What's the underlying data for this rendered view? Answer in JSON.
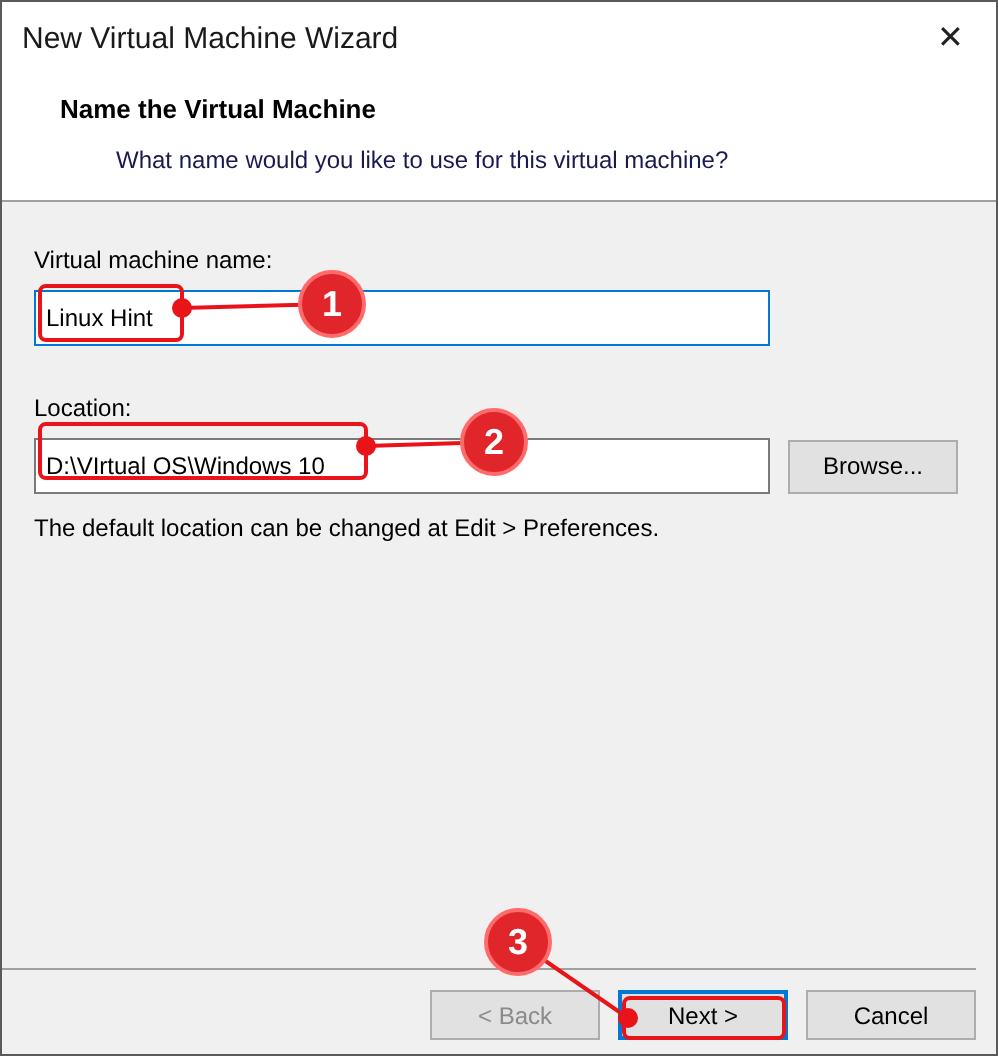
{
  "window": {
    "title": "New Virtual Machine Wizard",
    "close": "✕"
  },
  "header": {
    "title": "Name the Virtual Machine",
    "subtitle": "What name would you like to use for this virtual machine?"
  },
  "fields": [
    {
      "label": "Virtual machine name:",
      "value": "Linux Hint",
      "focused": true
    },
    {
      "label": "Location:",
      "value": "D:\\VIrtual OS\\Windows 10",
      "focused": false,
      "button": "Browse..."
    }
  ],
  "note": "The default location can be changed at Edit > Preferences.",
  "buttons": [
    {
      "label": "< Back",
      "disabled": true,
      "focused": false
    },
    {
      "label": "Next >",
      "disabled": false,
      "focused": true
    },
    {
      "label": "Cancel",
      "disabled": false,
      "focused": false
    }
  ],
  "annotations": [
    {
      "number": "1"
    },
    {
      "number": "2"
    },
    {
      "number": "3"
    }
  ]
}
